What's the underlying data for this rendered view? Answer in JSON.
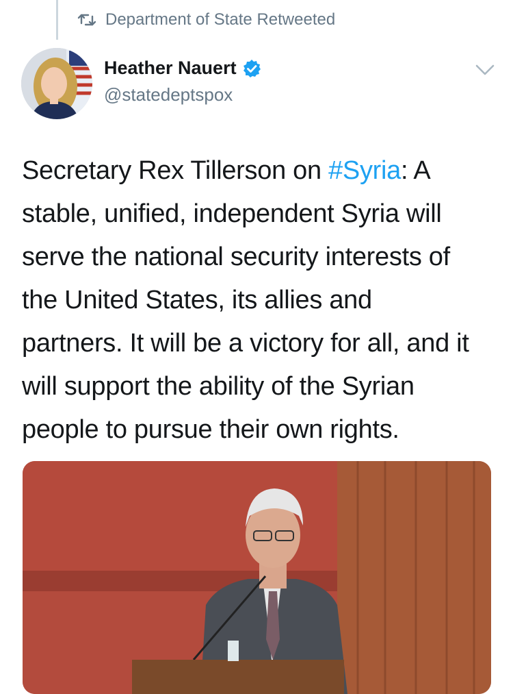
{
  "retweet": {
    "label": "Department of State Retweeted",
    "icon": "retweet-icon"
  },
  "author": {
    "name": "Heather Nauert",
    "handle": "@statedeptspox",
    "verified_icon": "verified-badge-icon",
    "verified_color": "#1da1f2"
  },
  "tweet": {
    "line1_before": "Secretary Rex Tillerson on ",
    "hashtag": "#Syria",
    "line1_after": ": A",
    "line2": "stable, unified, independent Syria will",
    "line3": "serve the national security interests of",
    "line4": "the United States, its allies and",
    "line5": "partners. It will be a victory for all, and it",
    "line6": "will support the ability of the Syrian",
    "line7": "people to pursue their own rights."
  },
  "colors": {
    "text": "#14171a",
    "secondary": "#657786",
    "link": "#1da1f2"
  }
}
